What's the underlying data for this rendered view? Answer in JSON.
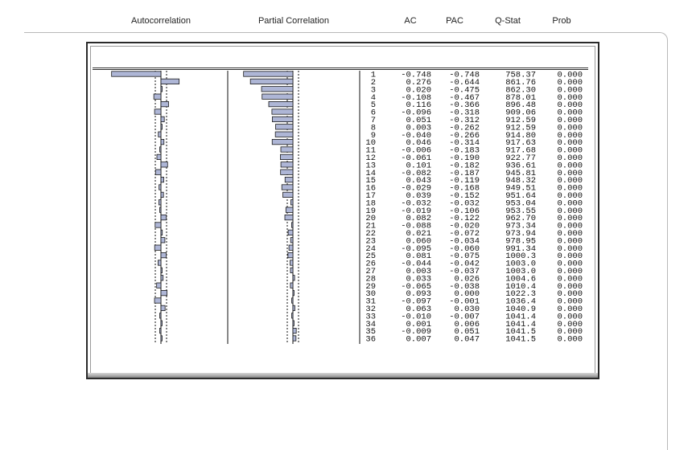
{
  "headers": {
    "autocorrelation": "Autocorrelation",
    "partial_correlation": "Partial Correlation",
    "ac": "AC",
    "pac": "PAC",
    "qstat": "Q-Stat",
    "prob": "Prob"
  },
  "colors": {
    "bar_fill": "#aeb6d6",
    "bar_stroke": "#1a1a1a",
    "axis_line": "#111111"
  },
  "chart_data": {
    "type": "table",
    "columns": [
      "",
      "AC",
      "PAC",
      "Q-Stat",
      "Prob"
    ],
    "lags": [
      1,
      2,
      3,
      4,
      5,
      6,
      7,
      8,
      9,
      10,
      11,
      12,
      13,
      14,
      15,
      16,
      17,
      18,
      19,
      20,
      21,
      22,
      23,
      24,
      25,
      26,
      27,
      28,
      29,
      30,
      31,
      32,
      33,
      34,
      35,
      36
    ],
    "ac": [
      "-0.748",
      "0.276",
      "0.020",
      "-0.108",
      "0.116",
      "-0.096",
      "0.051",
      "0.003",
      "-0.040",
      "0.046",
      "-0.006",
      "-0.061",
      "0.101",
      "-0.082",
      "0.043",
      "-0.029",
      "0.039",
      "-0.032",
      "-0.019",
      "0.082",
      "-0.088",
      "0.021",
      "0.060",
      "-0.095",
      "0.081",
      "-0.044",
      "0.003",
      "0.033",
      "-0.065",
      "0.093",
      "-0.097",
      "0.063",
      "-0.010",
      "0.001",
      "-0.009",
      "0.007"
    ],
    "pac": [
      "-0.748",
      "-0.644",
      "-0.475",
      "-0.467",
      "-0.366",
      "-0.318",
      "-0.312",
      "-0.262",
      "-0.266",
      "-0.314",
      "-0.183",
      "-0.190",
      "-0.182",
      "-0.187",
      "-0.119",
      "-0.168",
      "-0.152",
      "-0.032",
      "-0.106",
      "-0.122",
      "-0.020",
      "-0.072",
      "-0.034",
      "-0.060",
      "-0.075",
      "-0.042",
      "-0.037",
      "0.026",
      "-0.038",
      "0.000",
      "-0.001",
      "0.030",
      "-0.007",
      "0.006",
      "0.051",
      "0.047"
    ],
    "q_stat": [
      "758.37",
      "861.76",
      "862.30",
      "878.01",
      "896.48",
      "909.06",
      "912.59",
      "912.59",
      "914.80",
      "917.63",
      "917.68",
      "922.77",
      "936.61",
      "945.81",
      "948.32",
      "949.51",
      "951.64",
      "953.04",
      "953.55",
      "962.70",
      "973.34",
      "973.94",
      "978.95",
      "991.34",
      "1000.3",
      "1003.0",
      "1003.0",
      "1004.6",
      "1010.4",
      "1022.3",
      "1036.4",
      "1040.9",
      "1041.4",
      "1041.4",
      "1041.5",
      "1041.5"
    ],
    "prob": [
      "0.000",
      "0.000",
      "0.000",
      "0.000",
      "0.000",
      "0.000",
      "0.000",
      "0.000",
      "0.000",
      "0.000",
      "0.000",
      "0.000",
      "0.000",
      "0.000",
      "0.000",
      "0.000",
      "0.000",
      "0.000",
      "0.000",
      "0.000",
      "0.000",
      "0.000",
      "0.000",
      "0.000",
      "0.000",
      "0.000",
      "0.000",
      "0.000",
      "0.000",
      "0.000",
      "0.000",
      "0.000",
      "0.000",
      "0.000",
      "0.000",
      "0.000"
    ]
  }
}
